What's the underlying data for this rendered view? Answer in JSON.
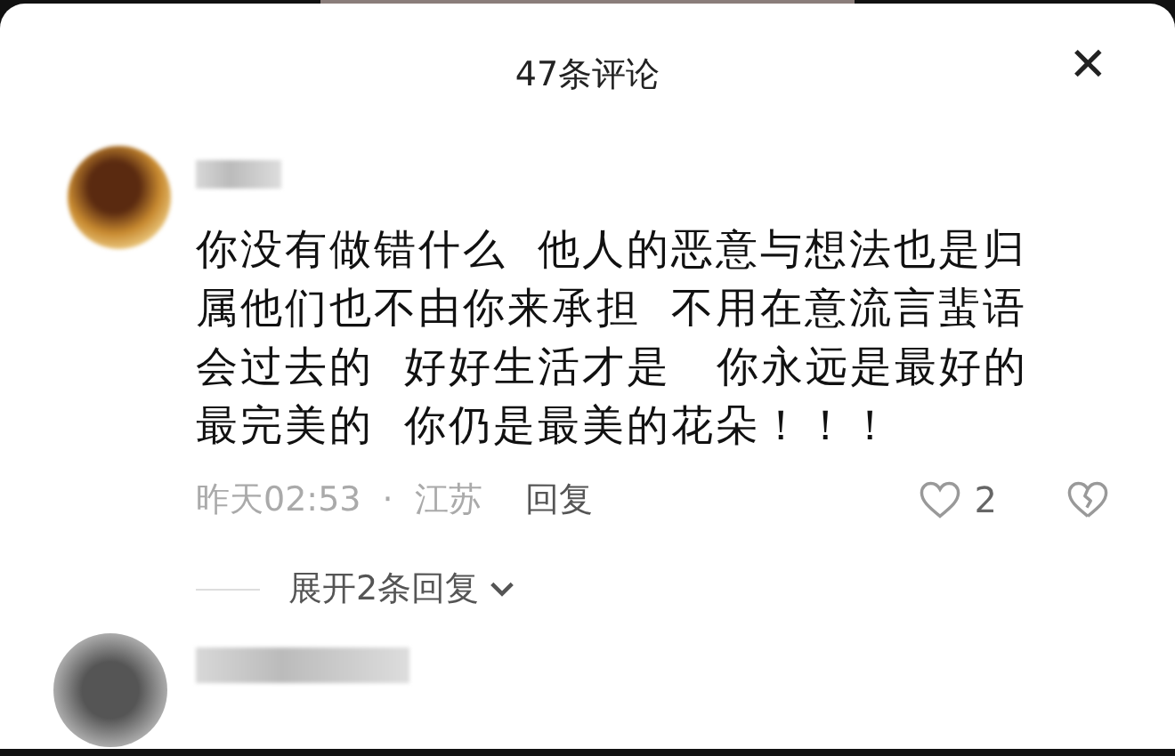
{
  "header": {
    "title": "47条评论",
    "close": "✕"
  },
  "comments": [
    {
      "kind": "warm",
      "text": "你没有做错什么  他人的恶意与想法也是归属他们也不由你来承担  不用在意流言蜚语会过去的  好好生活才是   你永远是最好的最完美的  你仍是最美的花朵！！！",
      "time": "昨天02:53",
      "separator": "·",
      "location": "江苏",
      "reply": "回复",
      "likes": "2",
      "expand": "展开2条回复"
    },
    {
      "kind": "gray"
    }
  ]
}
